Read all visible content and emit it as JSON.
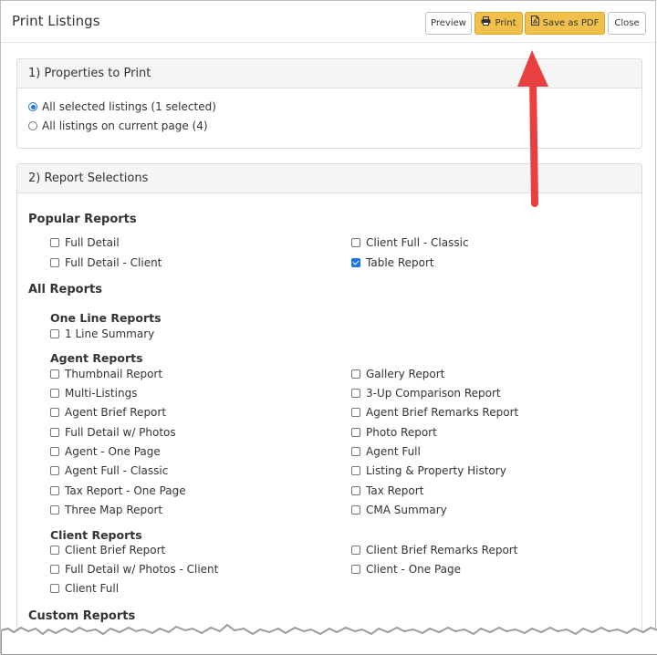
{
  "dialog": {
    "title": "Print Listings",
    "buttons": {
      "preview": "Preview",
      "print": "Print",
      "save_pdf": "Save as PDF",
      "close": "Close"
    }
  },
  "section1": {
    "heading": "1) Properties to Print",
    "options": [
      {
        "label": "All selected listings (1 selected)",
        "selected": true
      },
      {
        "label": "All listings on current page (4)",
        "selected": false
      }
    ]
  },
  "section2": {
    "heading": "2) Report Selections",
    "popular": {
      "heading": "Popular Reports",
      "items": [
        "Full Detail",
        "Client Full - Classic",
        "Full Detail - Client",
        "Table Report"
      ],
      "checked": [
        "Table Report"
      ]
    },
    "all_reports_heading": "All Reports",
    "one_line": {
      "heading": "One Line Reports",
      "items": [
        "1 Line Summary"
      ]
    },
    "agent": {
      "heading": "Agent Reports",
      "items": [
        "Thumbnail Report",
        "Gallery Report",
        "Multi-Listings",
        "3-Up Comparison Report",
        "Agent Brief Report",
        "Agent Brief Remarks Report",
        "Full Detail w/ Photos",
        "Photo Report",
        "Agent - One Page",
        "Agent Full",
        "Agent Full - Classic",
        "Listing & Property History",
        "Tax Report - One Page",
        "Tax Report",
        "Three Map Report",
        "CMA Summary"
      ]
    },
    "client": {
      "heading": "Client Reports",
      "items": [
        "Client Brief Report",
        "Client Brief Remarks Report",
        "Full Detail w/ Photos - Client",
        "Client - One Page",
        "Client Full"
      ]
    },
    "custom_heading": "Custom Reports"
  },
  "colors": {
    "accent": "#f0c04a",
    "check": "#1a73e8",
    "arrow": "#e8403e"
  }
}
